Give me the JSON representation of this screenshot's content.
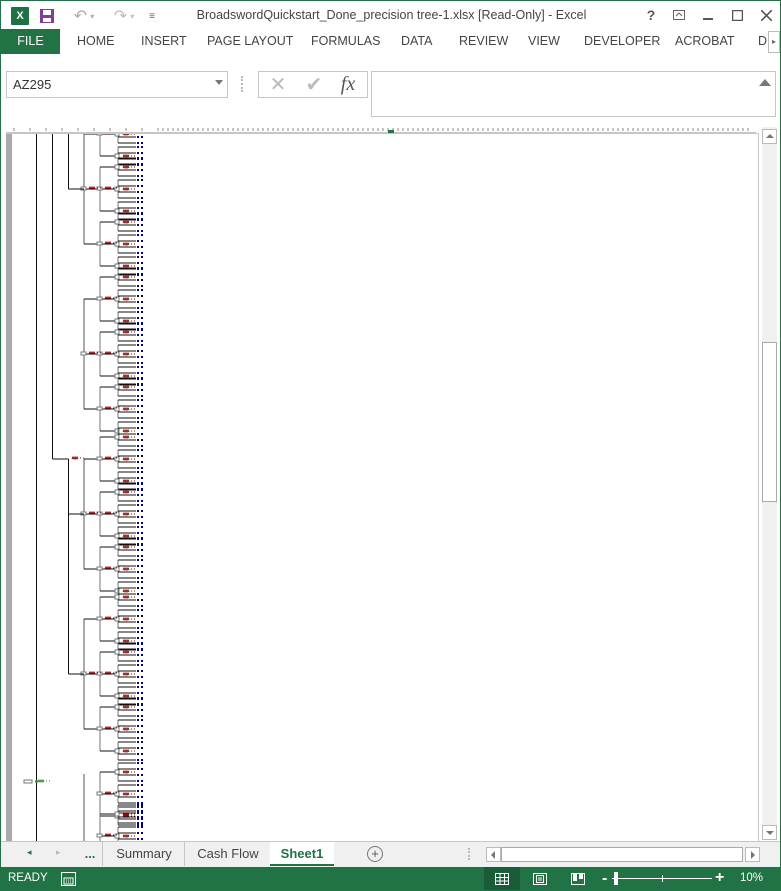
{
  "window": {
    "title": "BroadswordQuickstart_Done_precision tree-1.xlsx  [Read-Only] - Excel",
    "app_icon": "excel-icon",
    "quick_access": [
      "save-icon",
      "undo-icon",
      "redo-icon",
      "customize-qat-icon"
    ],
    "controls": [
      "help-icon",
      "ribbon-display-icon",
      "minimize-icon",
      "maximize-icon",
      "close-icon"
    ],
    "help_label": "?"
  },
  "ribbon": {
    "tabs": [
      {
        "label": "FILE",
        "active": true
      },
      {
        "label": "HOME"
      },
      {
        "label": "INSERT"
      },
      {
        "label": "PAGE LAYOUT"
      },
      {
        "label": "FORMULAS"
      },
      {
        "label": "DATA"
      },
      {
        "label": "REVIEW"
      },
      {
        "label": "VIEW"
      },
      {
        "label": "DEVELOPER"
      },
      {
        "label": "ACROBAT"
      },
      {
        "label": "DI"
      }
    ]
  },
  "formula_bar": {
    "name_box": "AZ295",
    "cancel_icon": "✕",
    "enter_icon": "✔",
    "fx_label": "fx",
    "formula": ""
  },
  "sheet": {
    "content": "decision-tree-diagram",
    "zoom_percent": 10
  },
  "sheet_tabs": {
    "more_label": "...",
    "tabs": [
      {
        "label": "Summary"
      },
      {
        "label": "Cash Flow"
      },
      {
        "label": "Sheet1",
        "active": true
      }
    ],
    "add_label": "+"
  },
  "status_bar": {
    "status": "READY",
    "zoom_label": "10%",
    "view_modes": [
      "normal-view",
      "page-layout-view",
      "page-break-preview"
    ],
    "active_view": "normal-view"
  },
  "colors": {
    "accent": "#217346",
    "tree_label": "#8b0000",
    "tree_leaf": "#00008b",
    "tree_chance": "#2e8b2e"
  }
}
